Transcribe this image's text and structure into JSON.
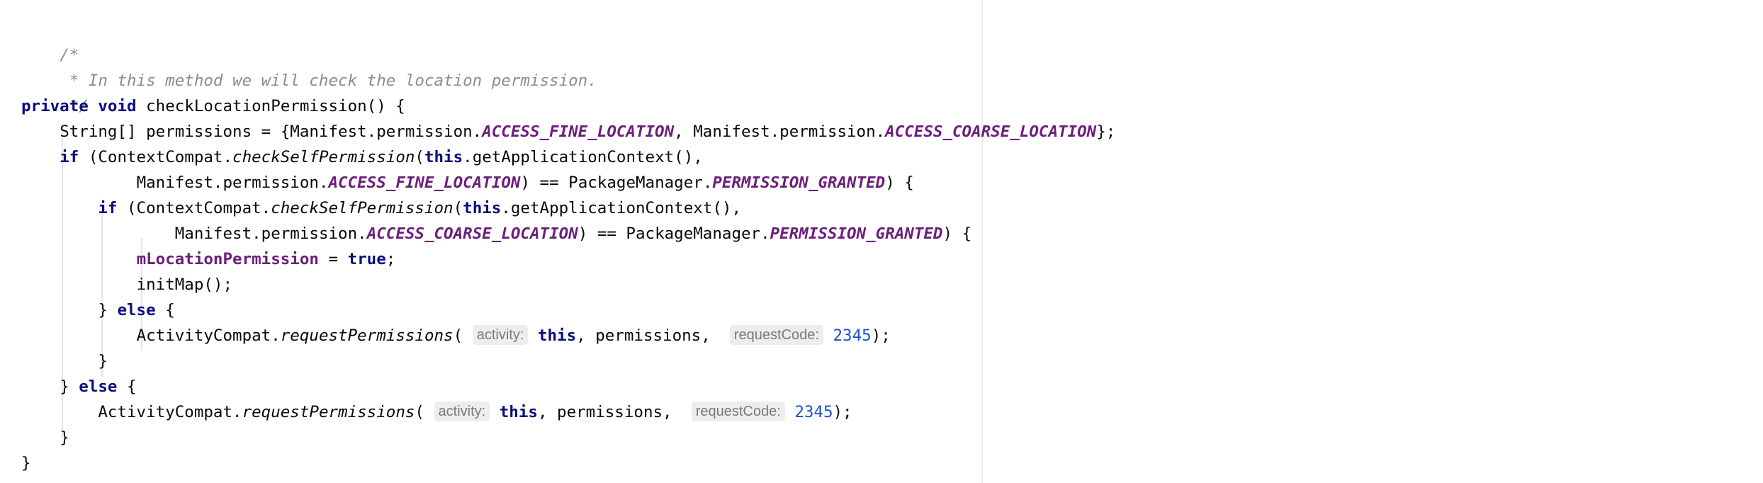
{
  "code": {
    "comment": {
      "open": "/*",
      "text": " * In this method we will check the location permission.",
      "close": " */"
    },
    "signature": {
      "modifier": "private",
      "return_type": "void",
      "rest": " checkLocationPermission() {"
    },
    "permissions_decl": {
      "prefix": "String[] permissions = {Manifest.permission.",
      "fine": "ACCESS_FINE_LOCATION",
      "mid": ", Manifest.permission.",
      "coarse": "ACCESS_COARSE_LOCATION",
      "suffix": "};"
    },
    "if_outer": {
      "kw": "if",
      "open": " (ContextCompat.",
      "method": "checkSelfPermission",
      "paren": "(",
      "this": "this",
      "rest": ".getApplicationContext(),"
    },
    "if_outer_cont": {
      "prefix": "Manifest.permission.",
      "constant": "ACCESS_FINE_LOCATION",
      "mid": ") == PackageManager.",
      "granted": "PERMISSION_GRANTED",
      "suffix": ") {"
    },
    "if_inner": {
      "kw": "if",
      "open": " (ContextCompat.",
      "method": "checkSelfPermission",
      "paren": "(",
      "this": "this",
      "rest": ".getApplicationContext(),"
    },
    "if_inner_cont": {
      "prefix": "Manifest.permission.",
      "constant": "ACCESS_COARSE_LOCATION",
      "mid": ") == PackageManager.",
      "granted": "PERMISSION_GRANTED",
      "suffix": ") {"
    },
    "assign": {
      "field": "mLocationPermission",
      "op": " = ",
      "value": "true",
      "end": ";"
    },
    "init_map": "initMap();",
    "inner_else": {
      "brace": "} ",
      "kw": "else",
      "open": " {"
    },
    "request_inner": {
      "prefix": "ActivityCompat.",
      "method": "requestPermissions",
      "paren": "(",
      "hint_activity": "activity:",
      "this": "this",
      "mid": ", permissions, ",
      "hint_request": "requestCode:",
      "code": "2345",
      "end": ");"
    },
    "close_inner": "}",
    "outer_else": {
      "brace": "} ",
      "kw": "else",
      "open": " {"
    },
    "request_outer": {
      "prefix": "ActivityCompat.",
      "method": "requestPermissions",
      "paren": "(",
      "hint_activity": "activity:",
      "this": "this",
      "mid": ", permissions, ",
      "hint_request": "requestCode:",
      "code": "2345",
      "end": ");"
    },
    "close_outer": "}",
    "close_method": "}"
  }
}
